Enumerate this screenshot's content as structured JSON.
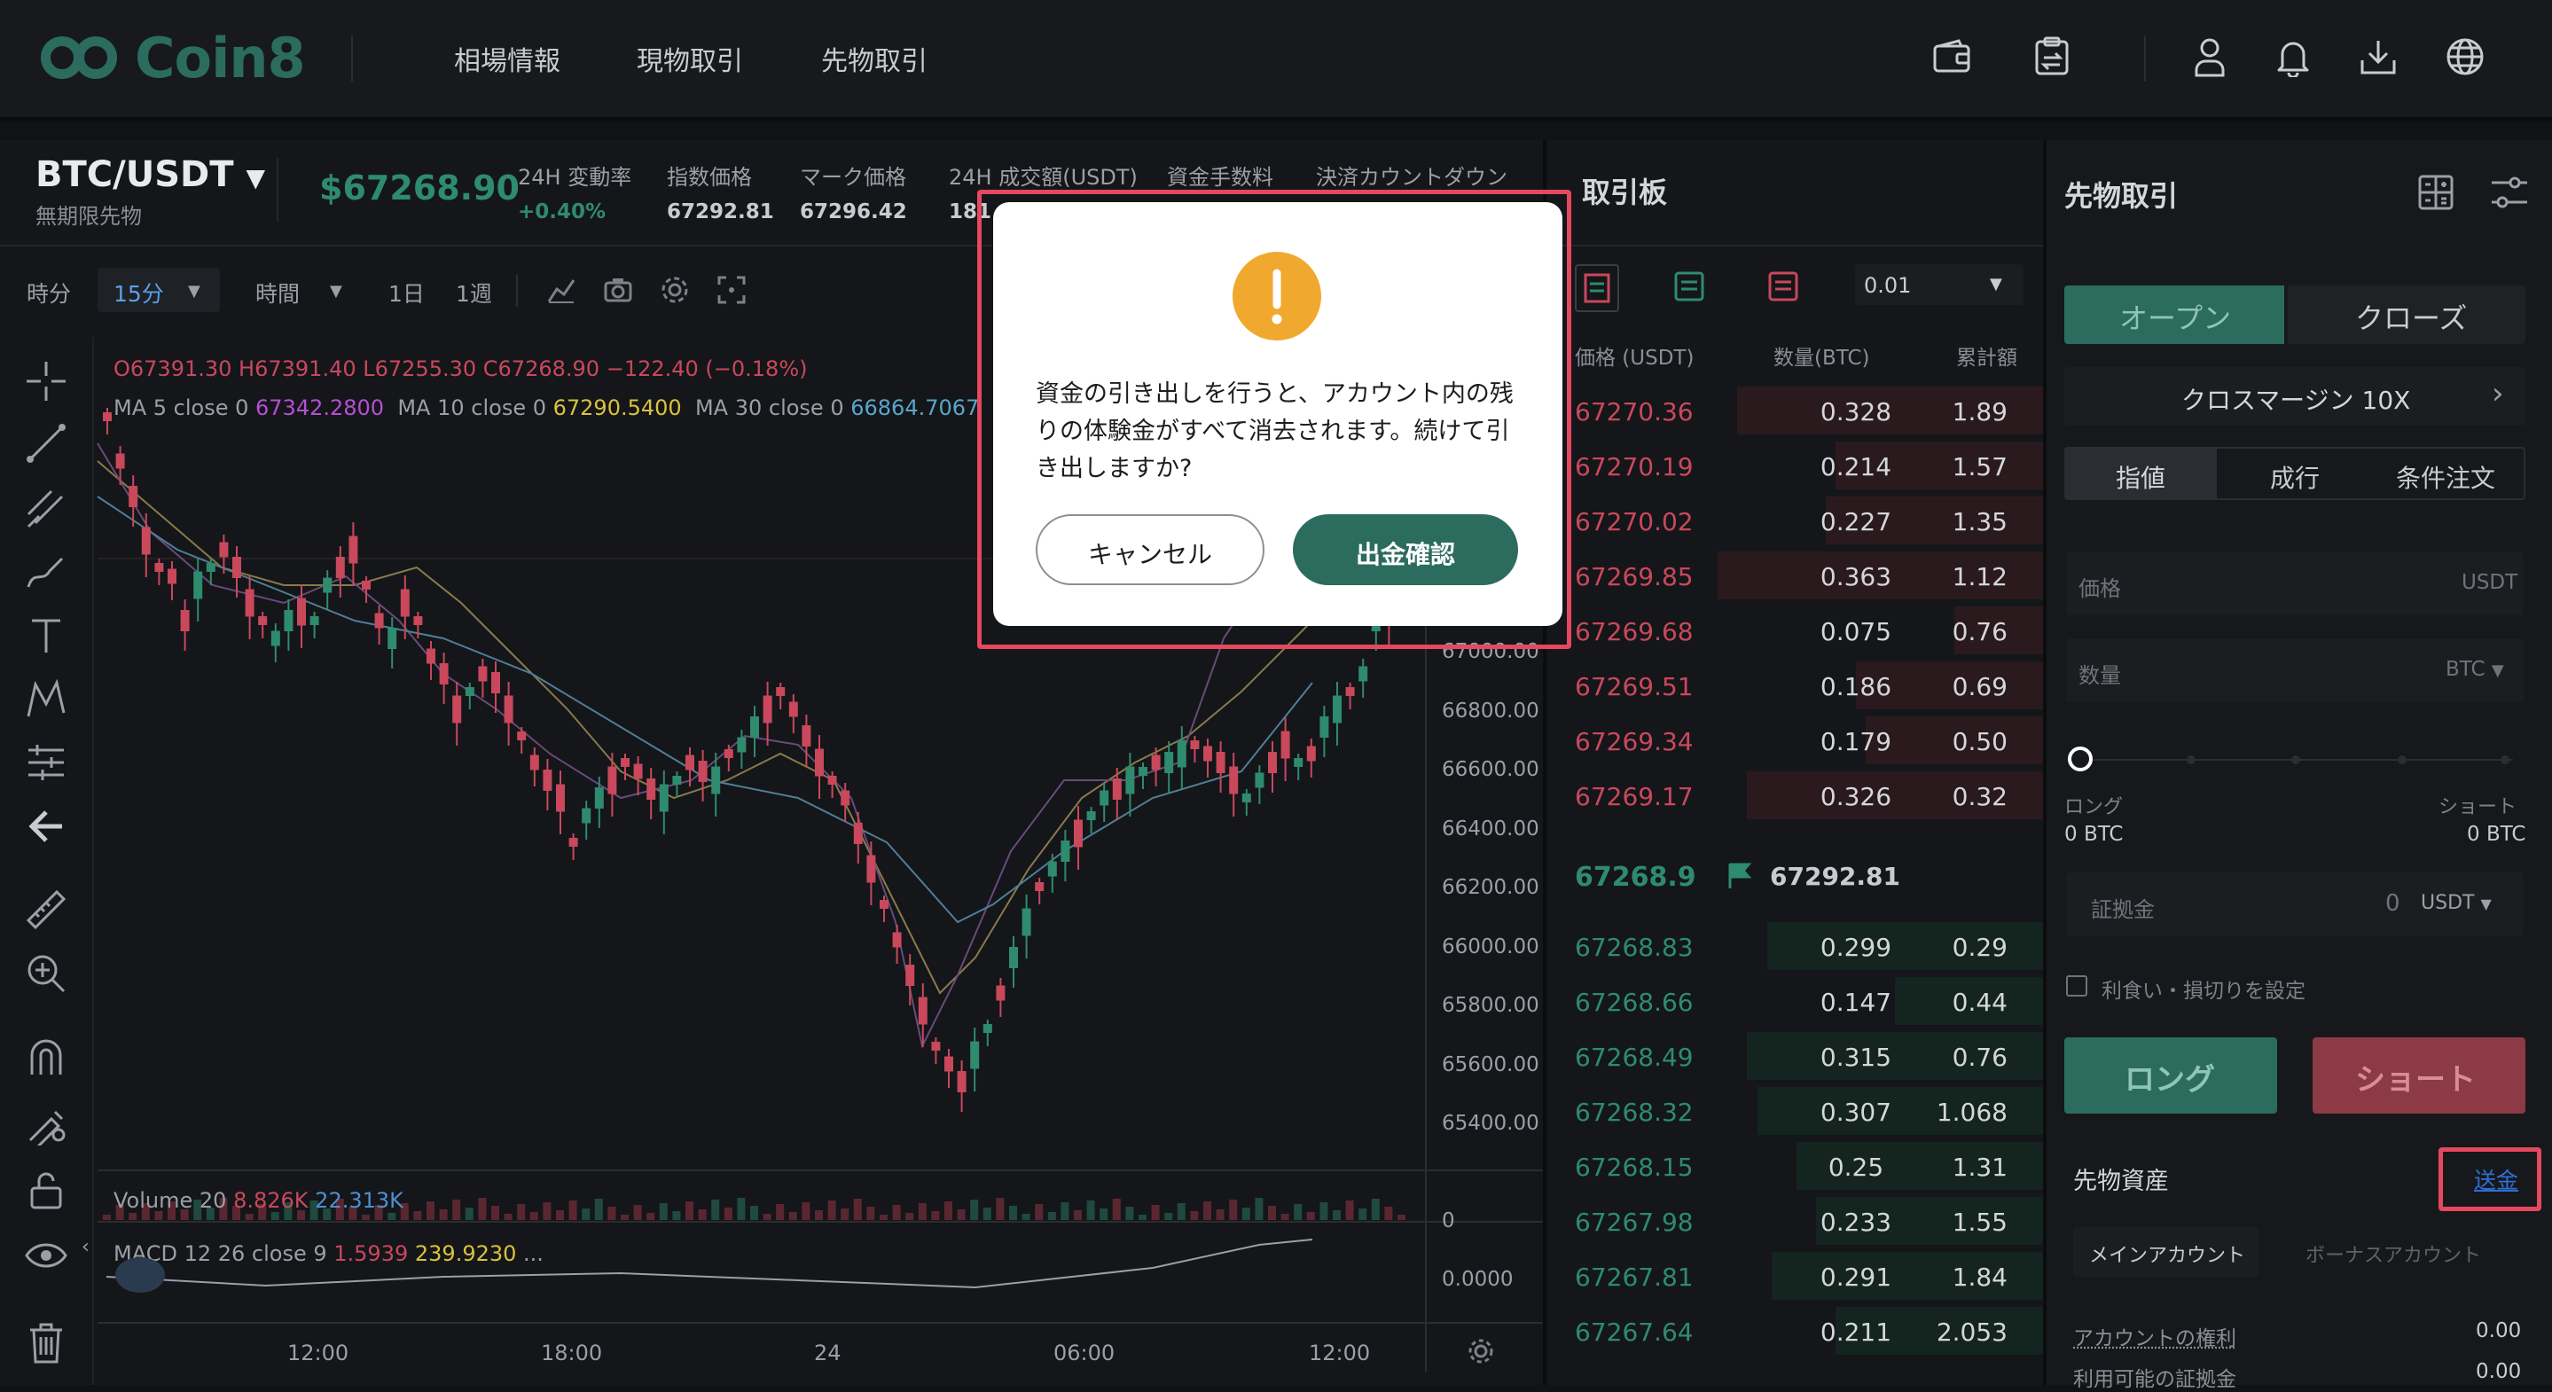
{
  "nav": {
    "logo_text": "Coin8",
    "links": [
      "相場情報",
      "現物取引",
      "先物取引"
    ]
  },
  "ticker": {
    "pair": "BTC/USDT",
    "pair_sub": "無期限先物",
    "last_price": "$67268.90",
    "stats": [
      {
        "label": "24H 変動率",
        "value": "+0.40%"
      },
      {
        "label": "指数価格",
        "value": "67292.81"
      },
      {
        "label": "マーク価格",
        "value": "67296.42"
      },
      {
        "label": "24H 成交額(USDT)",
        "value": "181"
      },
      {
        "label": "資金手数料",
        "value": ""
      },
      {
        "label": "決済カウントダウン",
        "value": ""
      }
    ]
  },
  "toolbar": {
    "timeframe_label": "時分",
    "interval_selected": "15分",
    "hours_label": "時間",
    "day_label": "1日",
    "week_label": "1週"
  },
  "chart": {
    "ohlc": {
      "o": "O67391.30",
      "h": "H67391.40",
      "l": "L67255.30",
      "c": "C67268.90",
      "change": "−122.40 (−0.18%)"
    },
    "ma": [
      {
        "label": "MA 5 close 0",
        "value": "67342.2800",
        "color": "#b54fd3"
      },
      {
        "label": "MA 10 close 0",
        "value": "67290.5400",
        "color": "#d9c23b"
      },
      {
        "label": "MA 30 close 0",
        "value": "66864.7067",
        "color": "#58a6c9"
      }
    ],
    "y_ticks": [
      "67000.00",
      "66800.00",
      "66600.00",
      "66400.00",
      "66200.00",
      "66000.00",
      "65800.00",
      "65600.00",
      "65400.00"
    ],
    "volume": {
      "label": "Volume 20",
      "v1": "8.826K",
      "v2": "22.313K",
      "axis": "0"
    },
    "macd": {
      "label": "MACD 12 26 close 9",
      "v1": "1.5939",
      "v2": "239.9230",
      "more": "...",
      "axis": "0.0000"
    },
    "x_ticks": [
      "12:00",
      "18:00",
      "24",
      "06:00",
      "12:00"
    ]
  },
  "orderbook": {
    "title": "取引板",
    "precision": "0.01",
    "headers": {
      "price": "価格 (USDT)",
      "qty": "数量(BTC)",
      "sum": "累計額"
    },
    "asks": [
      {
        "price": "67270.36",
        "qty": "0.328",
        "sum": "1.89",
        "depth": 0.62
      },
      {
        "price": "67270.19",
        "qty": "0.214",
        "sum": "1.57",
        "depth": 0.42
      },
      {
        "price": "67270.02",
        "qty": "0.227",
        "sum": "1.35",
        "depth": 0.44
      },
      {
        "price": "67269.85",
        "qty": "0.363",
        "sum": "1.12",
        "depth": 0.66
      },
      {
        "price": "67269.68",
        "qty": "0.075",
        "sum": "0.76",
        "depth": 0.18
      },
      {
        "price": "67269.51",
        "qty": "0.186",
        "sum": "0.69",
        "depth": 0.38
      },
      {
        "price": "67269.34",
        "qty": "0.179",
        "sum": "0.50",
        "depth": 0.36
      },
      {
        "price": "67269.17",
        "qty": "0.326",
        "sum": "0.32",
        "depth": 0.6
      }
    ],
    "mid": {
      "price": "67268.9",
      "index": "67292.81"
    },
    "bids": [
      {
        "price": "67268.83",
        "qty": "0.299",
        "sum": "0.29",
        "depth": 0.56
      },
      {
        "price": "67268.66",
        "qty": "0.147",
        "sum": "0.44",
        "depth": 0.3
      },
      {
        "price": "67268.49",
        "qty": "0.315",
        "sum": "0.76",
        "depth": 0.6
      },
      {
        "price": "67268.32",
        "qty": "0.307",
        "sum": "1.068",
        "depth": 0.58
      },
      {
        "price": "67268.15",
        "qty": "0.25",
        "sum": "1.31",
        "depth": 0.5
      },
      {
        "price": "67267.98",
        "qty": "0.233",
        "sum": "1.55",
        "depth": 0.46
      },
      {
        "price": "67267.81",
        "qty": "0.291",
        "sum": "1.84",
        "depth": 0.55
      },
      {
        "price": "67267.64",
        "qty": "0.211",
        "sum": "2.053",
        "depth": 0.42
      }
    ]
  },
  "trade": {
    "title": "先物取引",
    "open_label": "オープン",
    "close_label": "クローズ",
    "margin_label": "クロスマージン 10X",
    "order_types": [
      "指値",
      "成行",
      "条件注文"
    ],
    "price_placeholder": "価格",
    "price_unit": "USDT",
    "qty_placeholder": "数量",
    "qty_unit": "BTC",
    "long_label": "ロング",
    "short_label": "ショート",
    "long_amount": "0 BTC",
    "short_amount": "0 BTC",
    "margin_input_label": "証拠金",
    "margin_input_value": "0",
    "margin_unit": "USDT",
    "tpsl_label": "利食い・損切りを設定",
    "long_button": "ロング",
    "short_button": "ショート",
    "assets_title": "先物資産",
    "transfer_link": "送金",
    "main_account": "メインアカウント",
    "bonus_account": "ボーナスアカウント",
    "equity_label": "アカウントの権利",
    "equity_value": "0.00",
    "available_label": "利用可能の証拠金",
    "available_value": "0.00"
  },
  "modal": {
    "message": "資金の引き出しを行うと、アカウント内の残りの体験金がすべて消去されます。続けて引き出しますか?",
    "cancel_label": "キャンセル",
    "confirm_label": "出金確認"
  },
  "colors": {
    "up": "#2e8b6e",
    "down": "#c9485b",
    "accent": "#2b6c5f",
    "warning": "#f0a92e",
    "highlight": "#e5485f",
    "link": "#2f6fd6"
  }
}
